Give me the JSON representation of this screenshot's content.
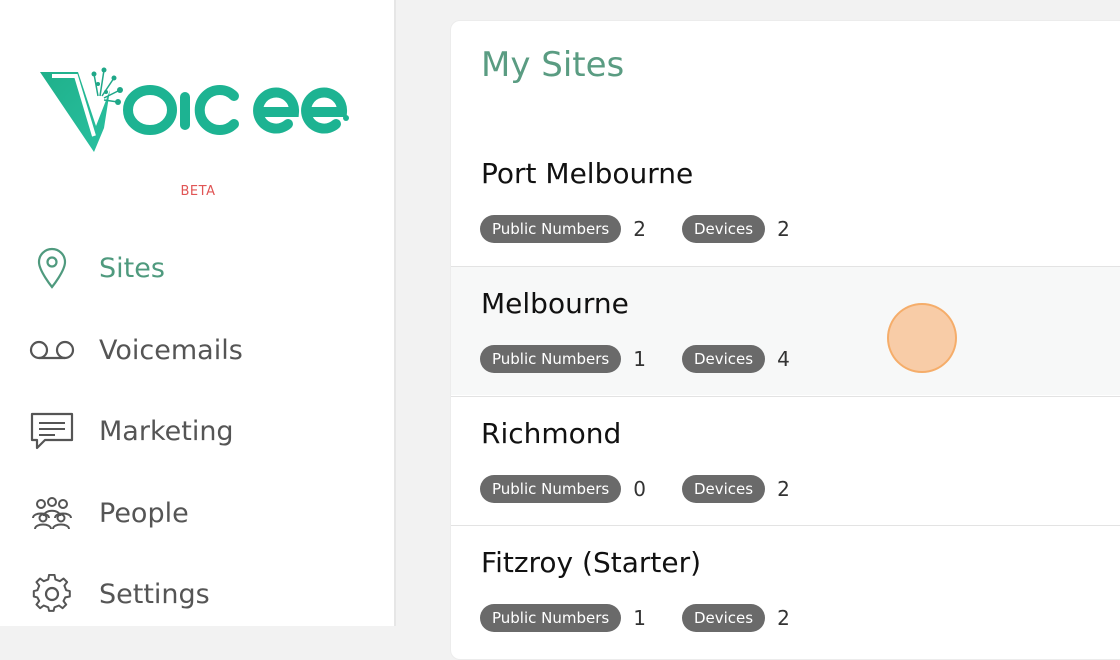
{
  "brand": {
    "name": "Voicee",
    "beta": "BETA",
    "accent": "#1db392",
    "text_accent": "#4f9a7e"
  },
  "nav": [
    {
      "label": "Sites",
      "icon": "location-pin-icon",
      "active": true
    },
    {
      "label": "Voicemails",
      "icon": "voicemail-icon",
      "active": false
    },
    {
      "label": "Marketing",
      "icon": "chat-message-icon",
      "active": false
    },
    {
      "label": "People",
      "icon": "people-group-icon",
      "active": false
    },
    {
      "label": "Settings",
      "icon": "gear-icon",
      "active": false
    }
  ],
  "main": {
    "title": "My Sites",
    "sites": [
      {
        "name": "Port Melbourne",
        "public_numbers_label": "Public Numbers",
        "public_numbers": "2",
        "devices_label": "Devices",
        "devices": "2"
      },
      {
        "name": "Melbourne",
        "public_numbers_label": "Public Numbers",
        "public_numbers": "1",
        "devices_label": "Devices",
        "devices": "4"
      },
      {
        "name": "Richmond",
        "public_numbers_label": "Public Numbers",
        "public_numbers": "0",
        "devices_label": "Devices",
        "devices": "2"
      },
      {
        "name": "Fitzroy (Starter)",
        "public_numbers_label": "Public Numbers",
        "public_numbers": "1",
        "devices_label": "Devices",
        "devices": "2"
      }
    ]
  }
}
